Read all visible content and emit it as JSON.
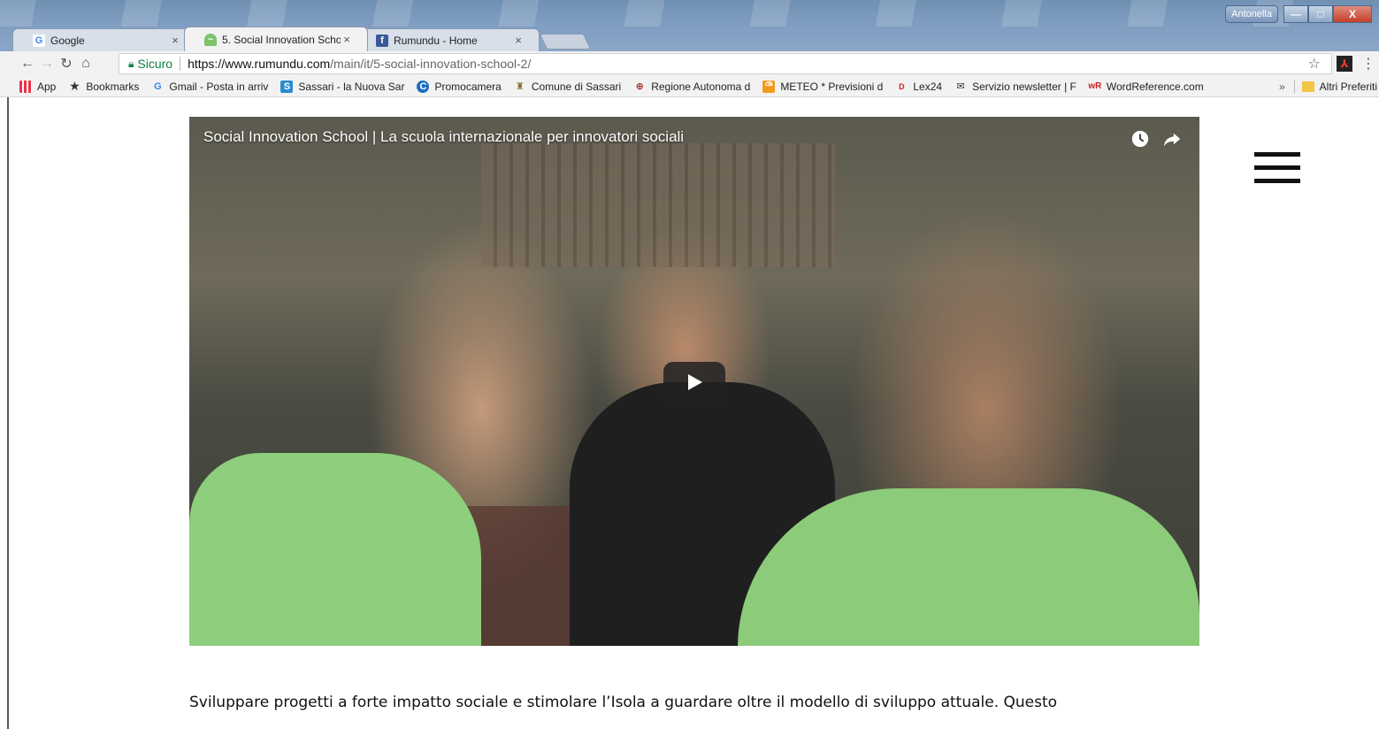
{
  "browser": {
    "tabs": [
      {
        "title": "Google",
        "icon": "google-icon",
        "active": false
      },
      {
        "title": "5. Social Innovation Scho",
        "icon": "rumundu-icon",
        "active": true
      },
      {
        "title": "Rumundu - Home",
        "icon": "facebook-icon",
        "active": false
      }
    ],
    "user": "Antonella",
    "window_controls": {
      "minimize": "—",
      "maximize": "□",
      "close": "X"
    },
    "security_label": "Sicuro",
    "url_domain": "https://www.rumundu.com",
    "url_path": "/main/it/5-social-innovation-school-2/"
  },
  "bookmarks": [
    {
      "label": "App",
      "icon": "apps-grid-icon"
    },
    {
      "label": "Bookmarks",
      "icon": "star-icon"
    },
    {
      "label": "Gmail - Posta in arriv",
      "icon": "google-icon"
    },
    {
      "label": "Sassari - la Nuova Sar",
      "icon": "news-icon"
    },
    {
      "label": "Promocamera",
      "icon": "promocamera-icon"
    },
    {
      "label": "Comune di Sassari",
      "icon": "crest-icon"
    },
    {
      "label": "Regione Autonoma d",
      "icon": "region-icon"
    },
    {
      "label": "METEO * Previsioni d",
      "icon": "meteo-icon"
    },
    {
      "label": "Lex24",
      "icon": "lex24-icon"
    },
    {
      "label": "Servizio newsletter | F",
      "icon": "mail-icon"
    },
    {
      "label": "WordReference.com",
      "icon": "wordreference-icon"
    }
  ],
  "bookmarks_more": "»",
  "bookmarks_other": "Altri Preferiti",
  "video": {
    "title": "Social Innovation School | La scuola internazionale per innovatori sociali"
  },
  "article": {
    "line1": "Sviluppare progetti a forte impatto sociale e stimolare l’Isola a guardare oltre il modello di sviluppo attuale. Questo"
  },
  "colors": {
    "secure_green": "#0b8043",
    "shirt_green": "#8dcf7c"
  }
}
